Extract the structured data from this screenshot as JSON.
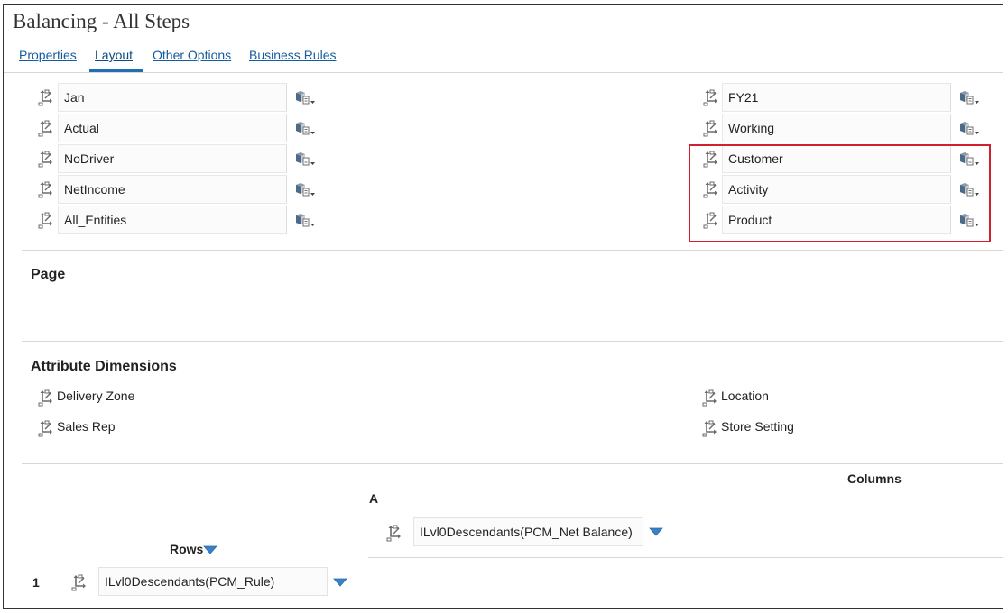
{
  "page_title": "Balancing - All Steps",
  "tabs": [
    {
      "label": "Properties"
    },
    {
      "label": "Layout"
    },
    {
      "label": "Other Options"
    },
    {
      "label": "Business Rules"
    }
  ],
  "pov_left": [
    "Jan",
    "Actual",
    "NoDriver",
    "NetIncome",
    "All_Entities"
  ],
  "pov_right": [
    "FY21",
    "Working",
    "Customer",
    "Activity",
    "Product"
  ],
  "page_section": {
    "title": "Page"
  },
  "attribute_dimensions": {
    "title": "Attribute Dimensions",
    "left": [
      "Delivery Zone",
      "Sales Rep"
    ],
    "right": [
      "Location",
      "Store Setting"
    ]
  },
  "columns": {
    "label": "Columns",
    "letter": "A",
    "member": "ILvl0Descendants(PCM_Net Balance)"
  },
  "rows": {
    "label": "Rows",
    "number": "1",
    "member": "ILvl0Descendants(PCM_Rule)"
  },
  "colors": {
    "accent": "#1f6fb2",
    "highlight": "#d2202e",
    "link": "#145c9e"
  }
}
